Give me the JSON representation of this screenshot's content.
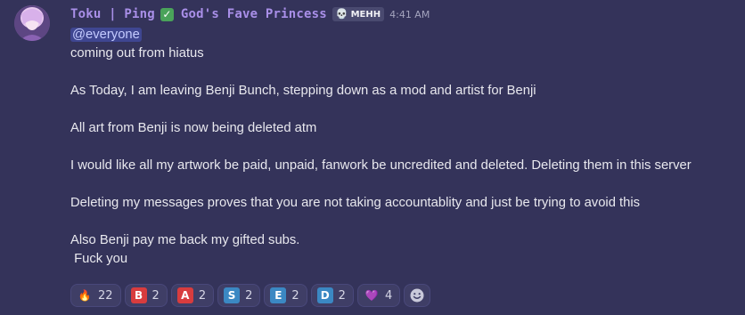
{
  "message": {
    "username": "Toku | Ping",
    "verified_icon": "check-mark-button-icon",
    "nickname_suffix": "God's Fave Princess",
    "role_tag": "MEHH",
    "role_icon": "skull-icon",
    "timestamp": "4:41 AM",
    "mention": "@everyone",
    "lines": [
      "coming out from hiatus",
      "",
      "As Today, I am leaving Benji Bunch, stepping down as a mod and artist for Benji",
      "",
      "All art from Benji is now being deleted atm",
      "",
      "I would like all my artwork be paid, unpaid, fanwork be uncredited and deleted. Deleting them in this server",
      "",
      "Deleting my messages proves that you are not taking accountablity and just be trying to avoid this",
      "",
      "Also Benji  pay me back my gifted subs.",
      " Fuck you"
    ]
  },
  "reactions": [
    {
      "emoji": "🔥",
      "icon": "fire-icon",
      "count": "22",
      "color": ""
    },
    {
      "emoji": "B",
      "icon": "letter-b-icon",
      "count": "2",
      "color": "#d83c3e"
    },
    {
      "emoji": "A",
      "icon": "letter-a-icon",
      "count": "2",
      "color": "#d83c3e"
    },
    {
      "emoji": "S",
      "icon": "letter-s-icon",
      "count": "2",
      "color": "#3b88c3"
    },
    {
      "emoji": "E",
      "icon": "letter-e-icon",
      "count": "2",
      "color": "#3b88c3"
    },
    {
      "emoji": "D",
      "icon": "letter-d-icon",
      "count": "2",
      "color": "#3b88c3"
    },
    {
      "emoji": "💜",
      "icon": "purple-heart-icon",
      "count": "4",
      "color": ""
    }
  ],
  "add_reaction_icon": "add-reaction-icon",
  "colors": {
    "background": "#34335a",
    "username": "#a98fe8",
    "mention_bg": "#3f4691",
    "mention_fg": "#c4cbff"
  }
}
